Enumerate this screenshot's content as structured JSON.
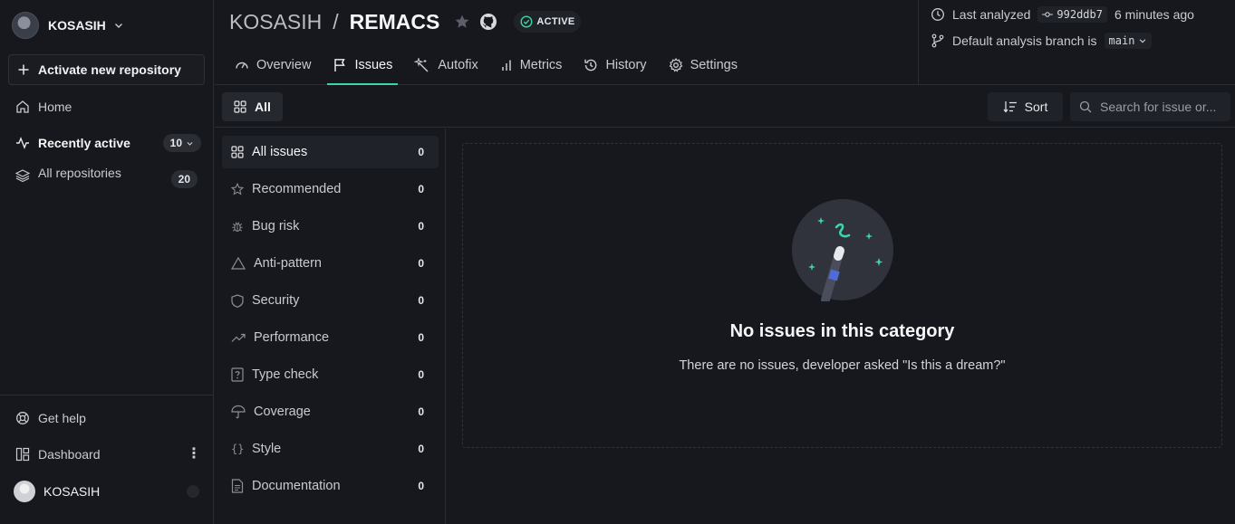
{
  "sidebar": {
    "org_name": "KOSASIH",
    "activate_label": "Activate new repository",
    "nav": [
      {
        "label": "Home"
      },
      {
        "label": "Recently active",
        "count": "10"
      },
      {
        "label": "All repositories",
        "count": "20"
      }
    ],
    "footer": [
      {
        "label": "Get help"
      },
      {
        "label": "Dashboard"
      }
    ],
    "user_name": "KOSASIH"
  },
  "header": {
    "owner": "KOSASIH",
    "separator": "/",
    "repo": "REMACS",
    "status": "ACTIVE",
    "tabs": [
      {
        "label": "Overview",
        "icon": "gauge-icon"
      },
      {
        "label": "Issues",
        "icon": "flag-icon"
      },
      {
        "label": "Autofix",
        "icon": "magic-wand-icon"
      },
      {
        "label": "Metrics",
        "icon": "bar-chart-icon"
      },
      {
        "label": "History",
        "icon": "history-icon"
      },
      {
        "label": "Settings",
        "icon": "gear-icon"
      }
    ],
    "active_tab": "Issues",
    "analysis": {
      "last_analyzed_label": "Last analyzed",
      "commit": "992ddb7",
      "time_ago": "6 minutes ago",
      "branch_label": "Default analysis branch is",
      "branch": "main"
    }
  },
  "toolbar": {
    "filter_all": "All",
    "sort_label": "Sort",
    "search_placeholder": "Search for issue or..."
  },
  "categories": [
    {
      "label": "All issues",
      "count": "0",
      "icon": "grid-icon"
    },
    {
      "label": "Recommended",
      "count": "0",
      "icon": "star-icon"
    },
    {
      "label": "Bug risk",
      "count": "0",
      "icon": "bug-icon"
    },
    {
      "label": "Anti-pattern",
      "count": "0",
      "icon": "warning-icon"
    },
    {
      "label": "Security",
      "count": "0",
      "icon": "shield-icon"
    },
    {
      "label": "Performance",
      "count": "0",
      "icon": "trend-icon"
    },
    {
      "label": "Type check",
      "count": "0",
      "icon": "question-box-icon"
    },
    {
      "label": "Coverage",
      "count": "0",
      "icon": "umbrella-icon"
    },
    {
      "label": "Style",
      "count": "0",
      "icon": "braces-icon"
    },
    {
      "label": "Documentation",
      "count": "0",
      "icon": "document-icon"
    }
  ],
  "empty_state": {
    "title": "No issues in this category",
    "subtitle": "There are no issues, developer asked \"Is this a dream?\""
  },
  "colors": {
    "accent": "#3dd5a6",
    "background": "#16181d",
    "surface": "#1f2228"
  }
}
